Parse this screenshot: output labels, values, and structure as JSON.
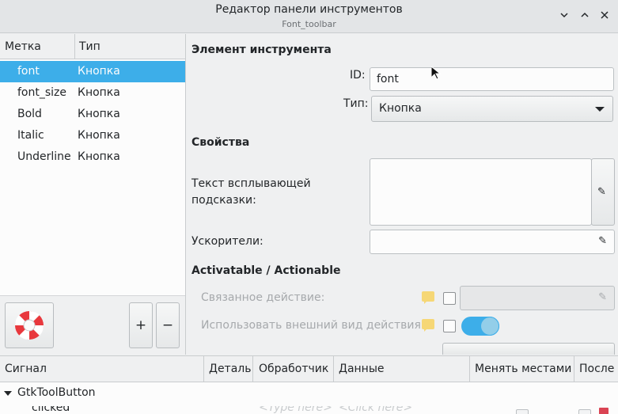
{
  "window": {
    "title": "Редактор панели инструментов",
    "subtitle": "Font_toolbar",
    "minimize_glyph": "⌄",
    "maximize_glyph": "⌃",
    "close_glyph": "✕"
  },
  "items_table": {
    "headers": {
      "label": "Метка",
      "type": "Тип"
    },
    "rows": [
      {
        "label": "font",
        "type": "Кнопка",
        "selected": true
      },
      {
        "label": "font_size",
        "type": "Кнопка",
        "selected": false
      },
      {
        "label": "Bold",
        "type": "Кнопка",
        "selected": false
      },
      {
        "label": "Italic",
        "type": "Кнопка",
        "selected": false
      },
      {
        "label": "Underline",
        "type": "Кнопка",
        "selected": false
      }
    ],
    "add_label": "+",
    "remove_label": "−"
  },
  "editor": {
    "section_item": "Элемент инструмента",
    "id_label": "ID:",
    "id_value": "font",
    "type_label": "Тип:",
    "type_value": "Кнопка",
    "section_props": "Свойства",
    "tooltip_label_1": "Текст всплывающей",
    "tooltip_label_2": "подсказки:",
    "tooltip_value": "",
    "accel_label": "Ускорители:",
    "accel_value": "",
    "section_action": "Activatable / Actionable",
    "related_action_label": "Связанное действие:",
    "related_action_value": "",
    "use_action_appearance_label": "Использовать внешний вид действия:",
    "use_action_appearance": true
  },
  "signals": {
    "headers": {
      "signal": "Сигнал",
      "detail": "Деталь",
      "handler": "Обработчик",
      "data": "Данные",
      "swap": "Менять местами",
      "after": "После"
    },
    "group": "GtkToolButton",
    "rows": [
      {
        "signal": "clicked",
        "handler": "<Type here>",
        "data": "<Click here>"
      }
    ]
  },
  "colors": {
    "accent": "#3daee9",
    "background": "#eff0f1",
    "view_background": "#fcfcfc"
  }
}
